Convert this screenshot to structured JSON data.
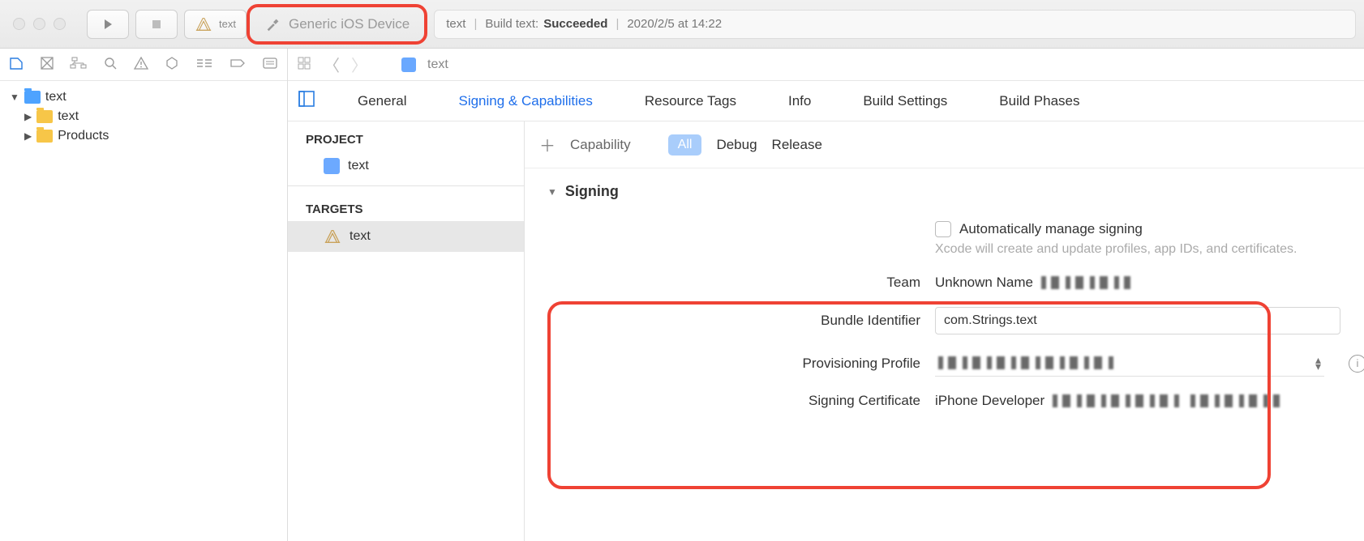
{
  "toolbar": {
    "scheme_label": "text",
    "device_label": "Generic iOS Device",
    "status_prefix": "text",
    "status_action": "Build text:",
    "status_result": "Succeeded",
    "status_time": "2020/2/5 at 14:22"
  },
  "sidebar": {
    "project_name": "text",
    "items": [
      "text",
      "Products"
    ]
  },
  "pathbar": {
    "crumb": "text"
  },
  "tabs": [
    "General",
    "Signing & Capabilities",
    "Resource Tags",
    "Info",
    "Build Settings",
    "Build Phases"
  ],
  "tabs_selected_index": 1,
  "navcol": {
    "project_header": "PROJECT",
    "project_name": "text",
    "targets_header": "TARGETS",
    "target_name": "text"
  },
  "capability": {
    "add_label": "Capability",
    "filter_all": "All",
    "filter_debug": "Debug",
    "filter_release": "Release"
  },
  "signing": {
    "section_title": "Signing",
    "auto_label": "Automatically manage signing",
    "auto_hint": "Xcode will create and update profiles, app IDs, and certificates.",
    "team_label": "Team",
    "team_value": "Unknown Name",
    "bundle_label": "Bundle Identifier",
    "bundle_value": "com.Strings.text",
    "profile_label": "Provisioning Profile",
    "cert_label": "Signing Certificate",
    "cert_value": "iPhone Developer"
  }
}
